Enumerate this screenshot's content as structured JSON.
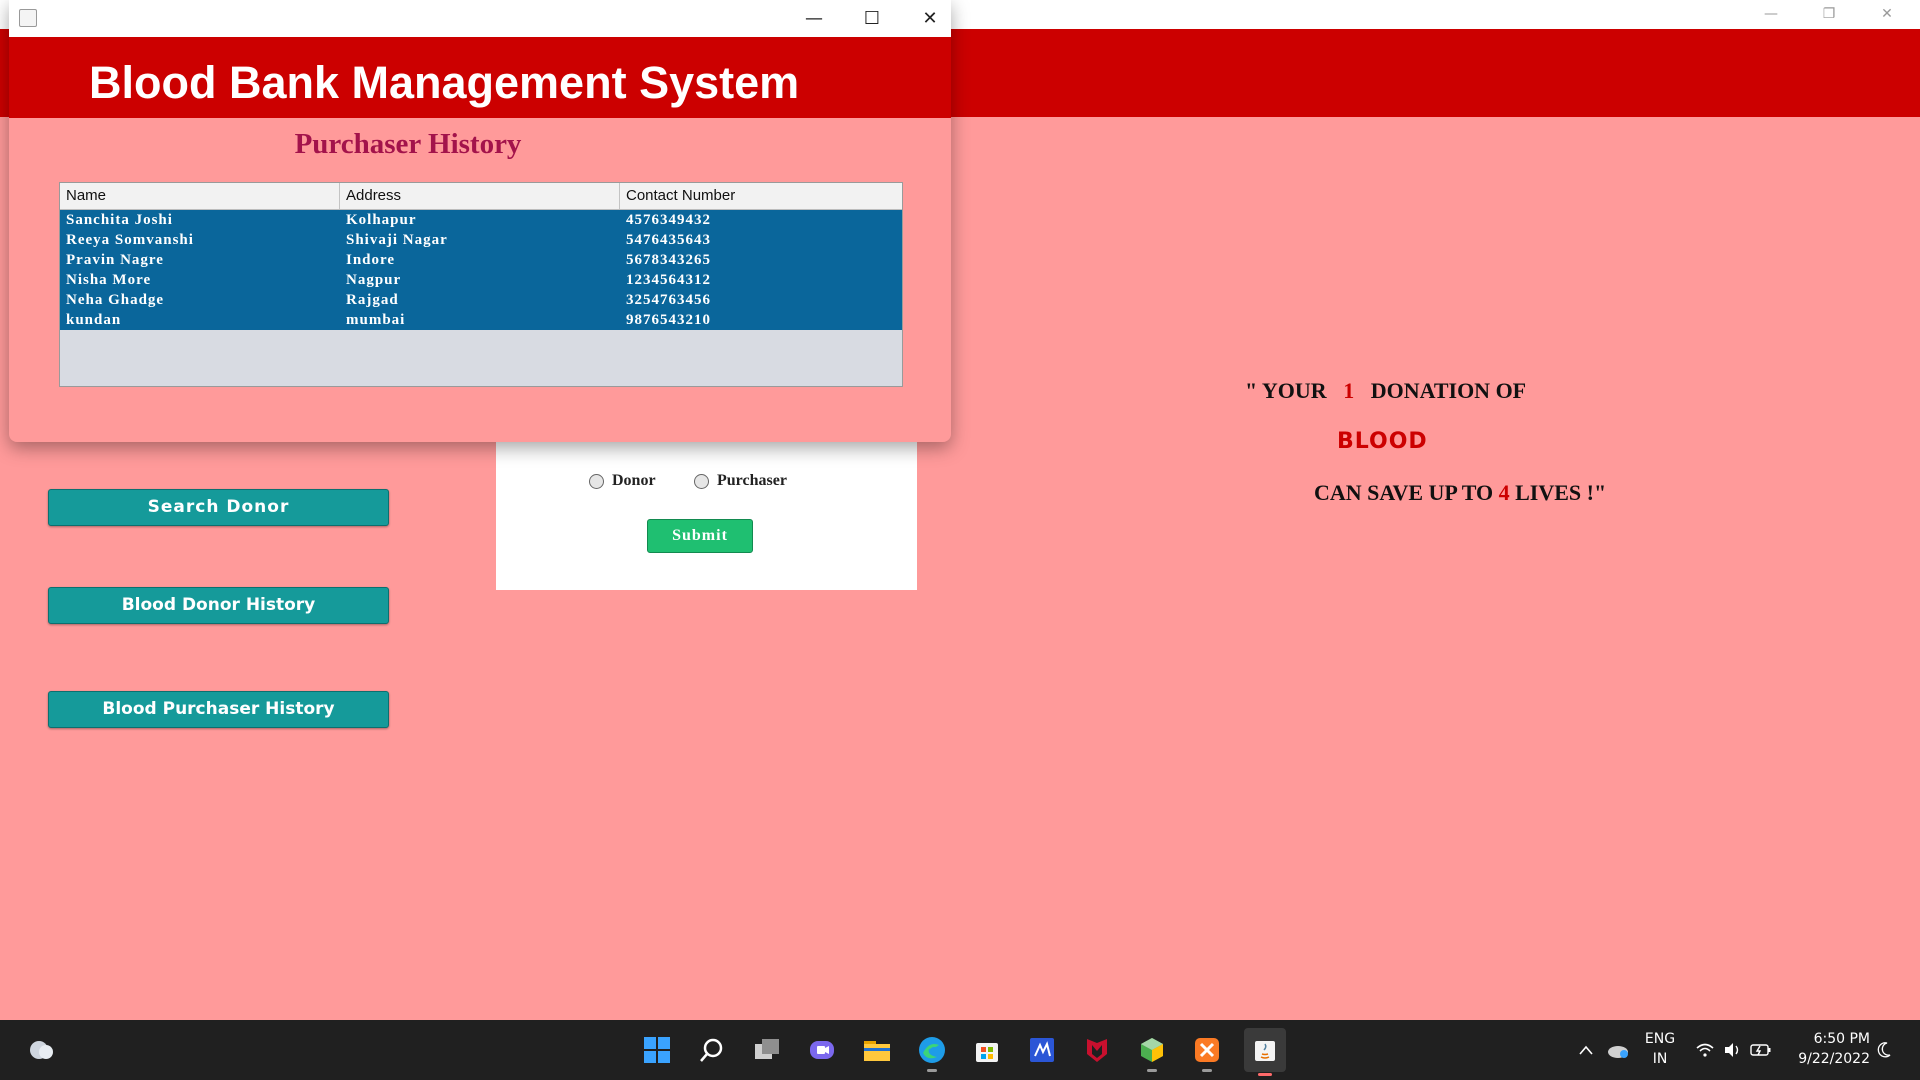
{
  "app": {
    "title": "Blood Bank Management System"
  },
  "dialog": {
    "heading": "Purchaser History",
    "table": {
      "columns": [
        "Name",
        "Address",
        "Contact Number"
      ],
      "rows": [
        [
          "Sanchita Joshi",
          "Kolhapur",
          "4576349432"
        ],
        [
          "Reeya Somvanshi",
          "Shivaji Nagar",
          "5476435643"
        ],
        [
          "Pravin Nagre",
          "Indore",
          "5678343265"
        ],
        [
          "Nisha More",
          "Nagpur",
          "1234564312"
        ],
        [
          "Neha Ghadge",
          "Rajgad",
          "3254763456"
        ],
        [
          "kundan",
          "mumbai",
          "9876543210"
        ]
      ]
    }
  },
  "sidebar": {
    "search_donor": "Search  Donor",
    "donor_history": "Blood Donor History",
    "purchaser_history": "Blood Purchaser History"
  },
  "search": {
    "radio_donor": "Donor",
    "radio_purchaser": "Purchaser",
    "submit": "Submit"
  },
  "quote": {
    "line1_a": "\" YOUR   ",
    "line1_num": "1",
    "line1_b": "   DONATION OF",
    "line2": "BLOOD",
    "line3_a": "CAN SAVE UP TO ",
    "line3_num": "4",
    "line3_b": " LIVES !\""
  },
  "taskbar": {
    "lang_top": "ENG",
    "lang_bottom": "IN",
    "time": "6:50 PM",
    "date": "9/22/2022",
    "apps": [
      "start-icon",
      "search-icon",
      "task-view-icon",
      "chat-icon",
      "file-explorer-icon",
      "edge-icon",
      "store-icon",
      "visual-studio-icon",
      "mcafee-icon",
      "cube-app-icon",
      "xampp-icon",
      "java-icon"
    ]
  },
  "colors": {
    "banner_red": "#cc0000",
    "background_pink": "#ff9a9a",
    "heading_maroon": "#a3134b",
    "table_selection": "#0a669b",
    "side_button_teal": "#159a9a",
    "submit_green": "#1fbf71"
  }
}
